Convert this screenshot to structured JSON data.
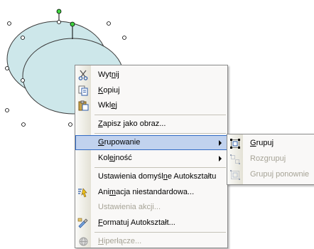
{
  "context_menu": {
    "items": [
      {
        "label_pre": "Wyt",
        "label_key": "n",
        "label_post": "ij",
        "icon": "scissors-icon",
        "enabled": true
      },
      {
        "label_pre": "",
        "label_key": "K",
        "label_post": "opiuj",
        "icon": "copy-icon",
        "enabled": true
      },
      {
        "label_pre": "Wkl",
        "label_key": "e",
        "label_post": "j",
        "icon": "paste-icon",
        "enabled": true
      },
      {
        "label_pre": "",
        "label_key": "Z",
        "label_post": "apisz jako obraz...",
        "icon": "",
        "enabled": true
      },
      {
        "label_pre": "",
        "label_key": "G",
        "label_post": "rupowanie",
        "icon": "",
        "enabled": true,
        "submenu": true,
        "highlighted": true
      },
      {
        "label_pre": "Kol",
        "label_key": "e",
        "label_post": "jność",
        "icon": "",
        "enabled": true,
        "submenu": true
      },
      {
        "label_pre": "Ustawienia domyśl",
        "label_key": "n",
        "label_post": "e Autokształtu",
        "icon": "",
        "enabled": true
      },
      {
        "label_pre": "Ani",
        "label_key": "m",
        "label_post": "acja niestandardowa...",
        "icon": "custom-animation-icon",
        "enabled": true
      },
      {
        "label_pre": "Ustawienia akcji...",
        "label_key": "",
        "label_post": "",
        "icon": "",
        "enabled": false
      },
      {
        "label_pre": "",
        "label_key": "F",
        "label_post": "ormatuj Autokształt...",
        "icon": "format-shape-icon",
        "enabled": true
      },
      {
        "label_pre": "",
        "label_key": "H",
        "label_post": "iperłącze...",
        "icon": "hyperlink-icon",
        "enabled": false
      }
    ]
  },
  "submenu": {
    "items": [
      {
        "label_pre": "",
        "label_key": "G",
        "label_post": "rupuj",
        "icon": "group-icon",
        "enabled": true
      },
      {
        "label_pre": "Roz",
        "label_key": "g",
        "label_post": "rupuj",
        "icon": "ungroup-icon",
        "enabled": false
      },
      {
        "label_pre": "Grupuj ponownie",
        "label_key": "",
        "label_post": "",
        "icon": "regroup-icon",
        "enabled": false
      }
    ]
  },
  "colors": {
    "shape_fill": "#cde7ea",
    "highlight": "#c1d2ee",
    "highlight_border": "#316ac5",
    "rotation_handle": "#3fd43f"
  }
}
